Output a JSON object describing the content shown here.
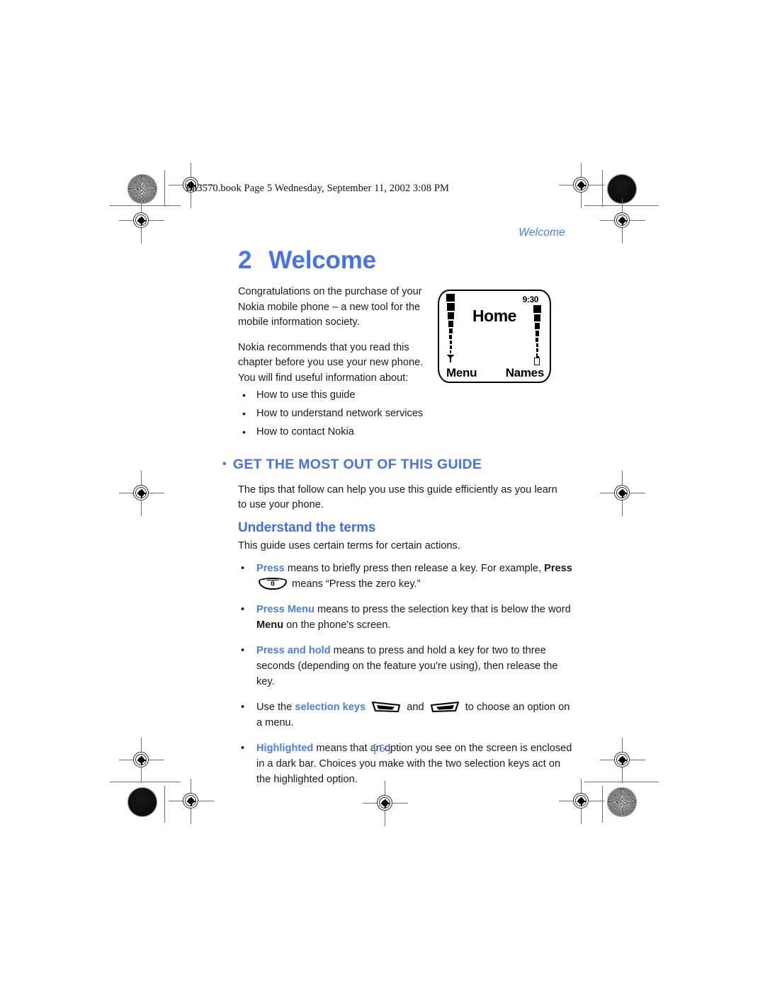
{
  "prepress": {
    "slug": "En3570.book  Page 5  Wednesday, September 11, 2002  3:08 PM"
  },
  "page": {
    "running_header": "Welcome",
    "chapter_number": "2",
    "chapter_title": "Welcome",
    "page_number": "5",
    "page_number_bracket_left": "[",
    "page_number_bracket_right": "]"
  },
  "intro": {
    "paragraph_1": "Congratulations on the purchase of your Nokia mobile phone – a new tool for the mobile information society.",
    "paragraph_2": "Nokia recommends that you read this chapter before you use your new phone. You will find useful information about:",
    "bullets": [
      "How to use this guide",
      "How to understand network services",
      "How to contact Nokia"
    ]
  },
  "phone_illustration": {
    "screen_title": "Home",
    "clock": "9:30",
    "softkey_left": "Menu",
    "softkey_right": "Names",
    "signal_icon": "antenna-icon",
    "battery_icon": "battery-icon"
  },
  "section": {
    "heading": "GET THE MOST OUT OF THIS GUIDE",
    "intro_paragraph": "The tips that follow can help you use this guide efficiently as you learn to use your phone.",
    "subheading": "Understand the terms",
    "subheading_intro": "This guide uses certain terms for certain actions."
  },
  "terms": [
    {
      "keyword": "Press",
      "text_before_icon": " means to briefly press then release a key. For example, ",
      "press_word": "Press",
      "icon": "zero-key-icon",
      "icon_label": "0",
      "text_after_icon": " means “Press the zero key.”"
    },
    {
      "keyword": "Press Menu",
      "text_1": " means to press the selection key that is below the word ",
      "bold_word": "Menu",
      "text_2": " on the phone's screen."
    },
    {
      "keyword": "Press and hold",
      "text_1": " means to press and hold a key for two to three seconds (depending on the feature you're using), then release the key."
    },
    {
      "lead": "Use the ",
      "keyword": "selection keys",
      "icon_left": "selection-key-left-icon",
      "conjunction": " and ",
      "icon_right": "selection-key-right-icon",
      "text_after": " to choose an option on a menu."
    },
    {
      "keyword": "Highlighted",
      "text_1": " means that an option you see on the screen is enclosed in a dark bar. Choices you make with the two selection keys act on the highlighted option."
    }
  ],
  "colors": {
    "accent_blue": "#4772ec",
    "link_blue": "#4a7dee",
    "body_text": "#1a1a1a"
  }
}
